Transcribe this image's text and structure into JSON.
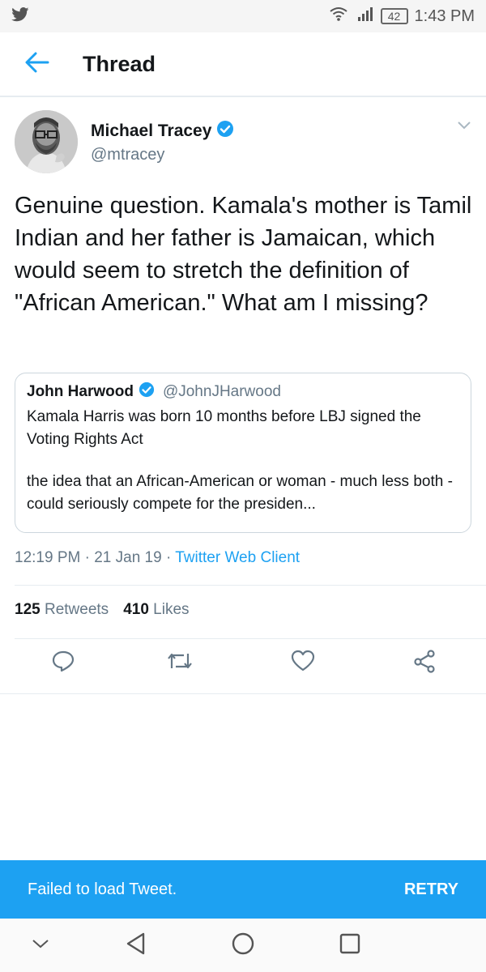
{
  "status_bar": {
    "time": "1:43 PM",
    "battery": "42",
    "icons": [
      "twitter-icon",
      "wifi-icon",
      "signal-icon",
      "battery-icon"
    ]
  },
  "header": {
    "title": "Thread",
    "back_icon": "arrow-left-icon"
  },
  "tweet": {
    "author": {
      "name": "Michael Tracey",
      "handle": "@mtracey",
      "verified": true
    },
    "text": "Genuine question. Kamala's mother is Tamil Indian and her father is Jamaican, which would seem to stretch the definition of \"African American.\" What am I missing?",
    "quoted": {
      "name": "John Harwood",
      "handle": "@JohnJHarwood",
      "verified": true,
      "text_line1": "Kamala Harris was born 10 months before LBJ signed the Voting Rights Act",
      "text_line2": "the idea that an African-American or woman - much less both - could seriously compete for the presiden..."
    },
    "time": "12:19 PM",
    "date": "21 Jan 19",
    "separator": "·",
    "client": "Twitter Web Client",
    "stats": {
      "retweets_count": "125",
      "retweets_label": "Retweets",
      "likes_count": "410",
      "likes_label": "Likes"
    },
    "actions": [
      "reply-icon",
      "retweet-icon",
      "like-icon",
      "share-icon"
    ]
  },
  "snackbar": {
    "message": "Failed to load Tweet.",
    "action": "RETRY"
  },
  "nav_bar": {
    "buttons": [
      "chevron-down-icon",
      "back-triangle-icon",
      "home-circle-icon",
      "recents-square-icon"
    ]
  },
  "colors": {
    "accent": "#1da1f2",
    "text": "#14171a",
    "secondary_text": "#657786",
    "divider": "#e6ecf0"
  }
}
